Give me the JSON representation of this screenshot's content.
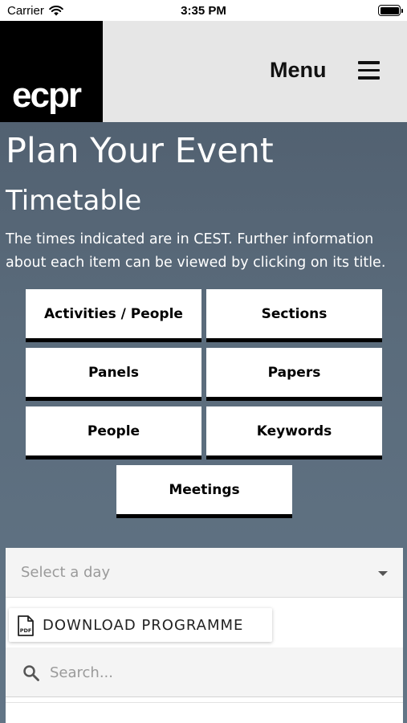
{
  "status_bar": {
    "carrier": "Carrier",
    "time": "3:35 PM"
  },
  "header": {
    "logo_text": "ecpr",
    "menu_label": "Menu"
  },
  "content": {
    "title": "Plan Your Event",
    "subtitle": "Timetable",
    "intro": "The times indicated are in CEST. Further information about each item can be viewed by clicking on its title."
  },
  "tiles": {
    "activities_people": "Activities / People",
    "sections": "Sections",
    "panels": "Panels",
    "papers": "Papers",
    "people": "People",
    "keywords": "Keywords",
    "meetings": "Meetings"
  },
  "filters": {
    "day_select_placeholder": "Select a day",
    "download_label": "DOWNLOAD PROGRAMME",
    "search_placeholder": "Search..."
  },
  "icons": {
    "wifi": "wifi-icon",
    "battery": "battery-icon",
    "hamburger": "hamburger-menu-icon",
    "pdf": "pdf-file-icon",
    "search": "search-icon",
    "caret": "chevron-down-icon"
  }
}
